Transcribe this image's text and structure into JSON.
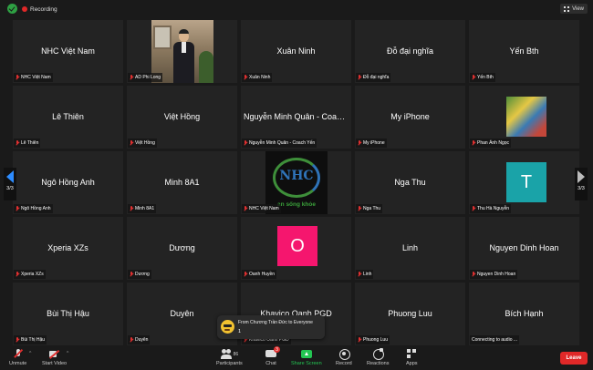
{
  "topbar": {
    "recording_label": "Recording",
    "view_label": "View"
  },
  "tiles": [
    {
      "center": "NHC Việt Nam",
      "label": "NHC Việt Nam"
    },
    {
      "center": "",
      "label": "AD Phi Long"
    },
    {
      "center": "Xuân Ninh",
      "label": "Xuân Ninh"
    },
    {
      "center": "Đỗ đại nghĩa",
      "label": "Đỗ đại nghĩa"
    },
    {
      "center": "Yến Bth",
      "label": "Yến Bth"
    },
    {
      "center": "Lê Thiên",
      "label": "Lê Thiên"
    },
    {
      "center": "Việt Hồng",
      "label": "Việt Hồng"
    },
    {
      "center": "Nguyễn Minh Quân - Coach Yến",
      "label": "Nguyễn Minh Quân - Coach Yến"
    },
    {
      "center": "My iPhone",
      "label": "My iPhone"
    },
    {
      "center": "",
      "label": "Phan Ánh Ngọc"
    },
    {
      "center": "Ngô Hồng Anh",
      "label": "Ngô Hồng Anh"
    },
    {
      "center": "Minh 8A1",
      "label": "Minh 8A1"
    },
    {
      "center": "",
      "label": "NHC Việt Nam",
      "logo_text": "NHC",
      "logo_sub": "an sống khỏe"
    },
    {
      "center": "Nga Thu",
      "label": "Nga Thu"
    },
    {
      "center": "",
      "label": "Thu Hà Nguyễn",
      "avatar": "T",
      "avatar_color": "#1aa3a8"
    },
    {
      "center": "Xperia XZs",
      "label": "Xperia XZs"
    },
    {
      "center": "Dương",
      "label": "Dương"
    },
    {
      "center": "",
      "label": "Oanh Huyền",
      "avatar": "O",
      "avatar_color": "#f5166e"
    },
    {
      "center": "Linh",
      "label": "Linh"
    },
    {
      "center": "Nguyen Dinh Hoan",
      "label": "Nguyen Dinh Hoan"
    },
    {
      "center": "Bùi Thị Hậu",
      "label": "Bùi Thị Hậu"
    },
    {
      "center": "Duyên",
      "label": "Duyên"
    },
    {
      "center": "Khavico Oanh PGD",
      "label": "Khavico Oanh PGD"
    },
    {
      "center": "Phuong Luu",
      "label": "Phuong Luu"
    },
    {
      "center": "Bích Hạnh",
      "label": "Connecting to audio ..."
    }
  ],
  "pager": {
    "left": "3/3",
    "right": "3/3"
  },
  "chat_toast": {
    "title": "From Chương Trần Đức to Everyone",
    "message": "1"
  },
  "toolbar": {
    "unmute": "Unmute",
    "start_video": "Start Video",
    "participants": "Participants",
    "participants_count": "86",
    "chat": "Chat",
    "chat_badge": "3",
    "share_screen": "Share Screen",
    "record": "Record",
    "reactions": "Reactions",
    "apps": "Apps",
    "leave": "Leave"
  },
  "colors": {
    "background": "#1a1a1a",
    "tile": "#232323",
    "leave": "#e02828",
    "share": "#23c552",
    "nav_active": "#2d8cff"
  }
}
